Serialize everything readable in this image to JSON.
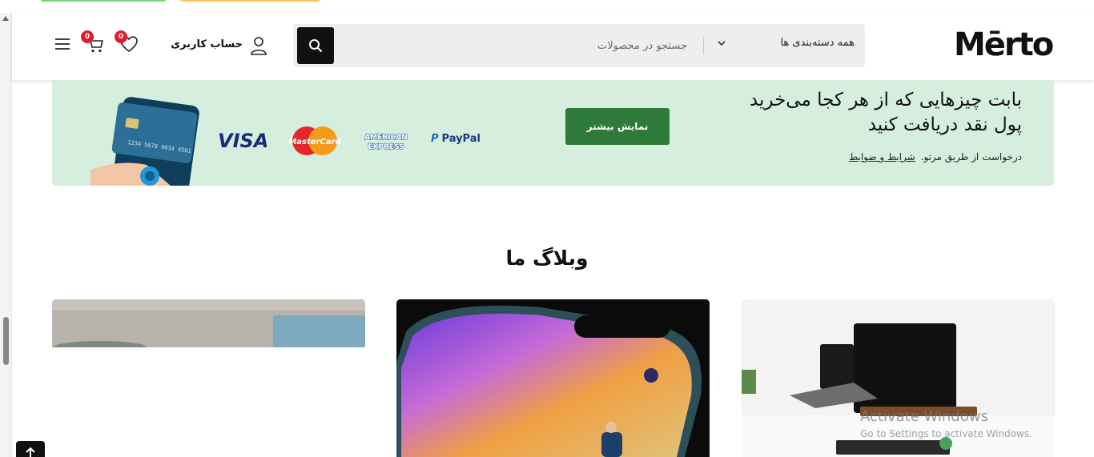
{
  "brand": {
    "logo_text": "Mērto"
  },
  "header": {
    "search": {
      "placeholder": "جستجو در محصولات",
      "category_label": "همه دسته‌بندی ها",
      "search_icon": "search-icon",
      "chevron_icon": "chevron-down-icon"
    },
    "account": {
      "label": "حساب کاربری",
      "icon": "user-icon"
    },
    "wishlist": {
      "count": "0",
      "icon": "heart-icon"
    },
    "cart": {
      "count": "0",
      "icon": "cart-icon"
    },
    "menu": {
      "icon": "hamburger-menu-icon"
    }
  },
  "banner": {
    "title_line1": "بابت چیزهایی که از هر کجا می‌خرید",
    "title_line2": "پول نقد دریافت کنید",
    "note": "درخواست از طریق مرتو.",
    "terms_link": "شرایط و ضوابط",
    "button_label": "نمایش بیشتر",
    "payment_logos": [
      "VISA",
      "MasterCard",
      "AMERICAN EXPRESS",
      "PayPal"
    ]
  },
  "blog": {
    "title": "وبلاگ ما",
    "cards": [
      {
        "image": "laptops-on-desk-image"
      },
      {
        "image": "smartphone-keynote-image"
      },
      {
        "image": "wooden-desk-image"
      }
    ]
  },
  "watermark": {
    "title": "Activate Windows",
    "subtitle": "Go to Settings to activate Windows."
  },
  "colors": {
    "banner_bg": "#d6eedd",
    "button_green": "#2d7a3a",
    "badge_red": "#e11d2b",
    "search_bg": "#eceef0"
  }
}
